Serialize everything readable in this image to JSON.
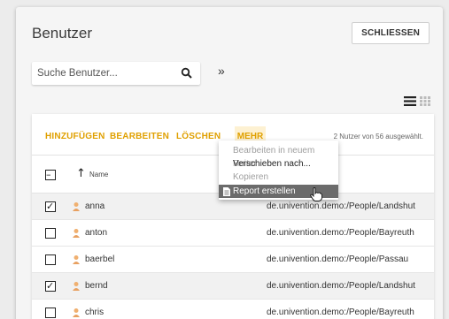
{
  "header": {
    "title": "Benutzer",
    "close_label": "SCHLIESSEN"
  },
  "search": {
    "placeholder": "Suche Benutzer...",
    "more_label": "»"
  },
  "toolbar": {
    "add_label": "HINZUFÜGEN",
    "edit_label": "BEARBEITEN",
    "delete_label": "LÖSCHEN",
    "more_label": "MEHR",
    "selection_status": "2 Nutzer von 56 ausgewählt."
  },
  "columns": {
    "name_label": "Name"
  },
  "menu": {
    "items": [
      {
        "label": "Bearbeiten in neuem Reiter",
        "state": "disabled"
      },
      {
        "label": "Verschieben nach...",
        "state": "normal"
      },
      {
        "label": "Kopieren",
        "state": "disabled"
      },
      {
        "label": "Report erstellen",
        "state": "hover",
        "icon": "report-icon"
      }
    ]
  },
  "rows": [
    {
      "name": "anna",
      "path": "de.univention.demo:/People/Landshut",
      "checked": true
    },
    {
      "name": "anton",
      "path": "de.univention.demo:/People/Bayreuth",
      "checked": false
    },
    {
      "name": "baerbel",
      "path": "de.univention.demo:/People/Passau",
      "checked": false
    },
    {
      "name": "bernd",
      "path": "de.univention.demo:/People/Landshut",
      "checked": true
    },
    {
      "name": "chris",
      "path": "de.univention.demo:/People/Bayreuth",
      "checked": false
    }
  ],
  "colors": {
    "accent": "#e0a000",
    "menu_hover": "#6b6b6b"
  }
}
